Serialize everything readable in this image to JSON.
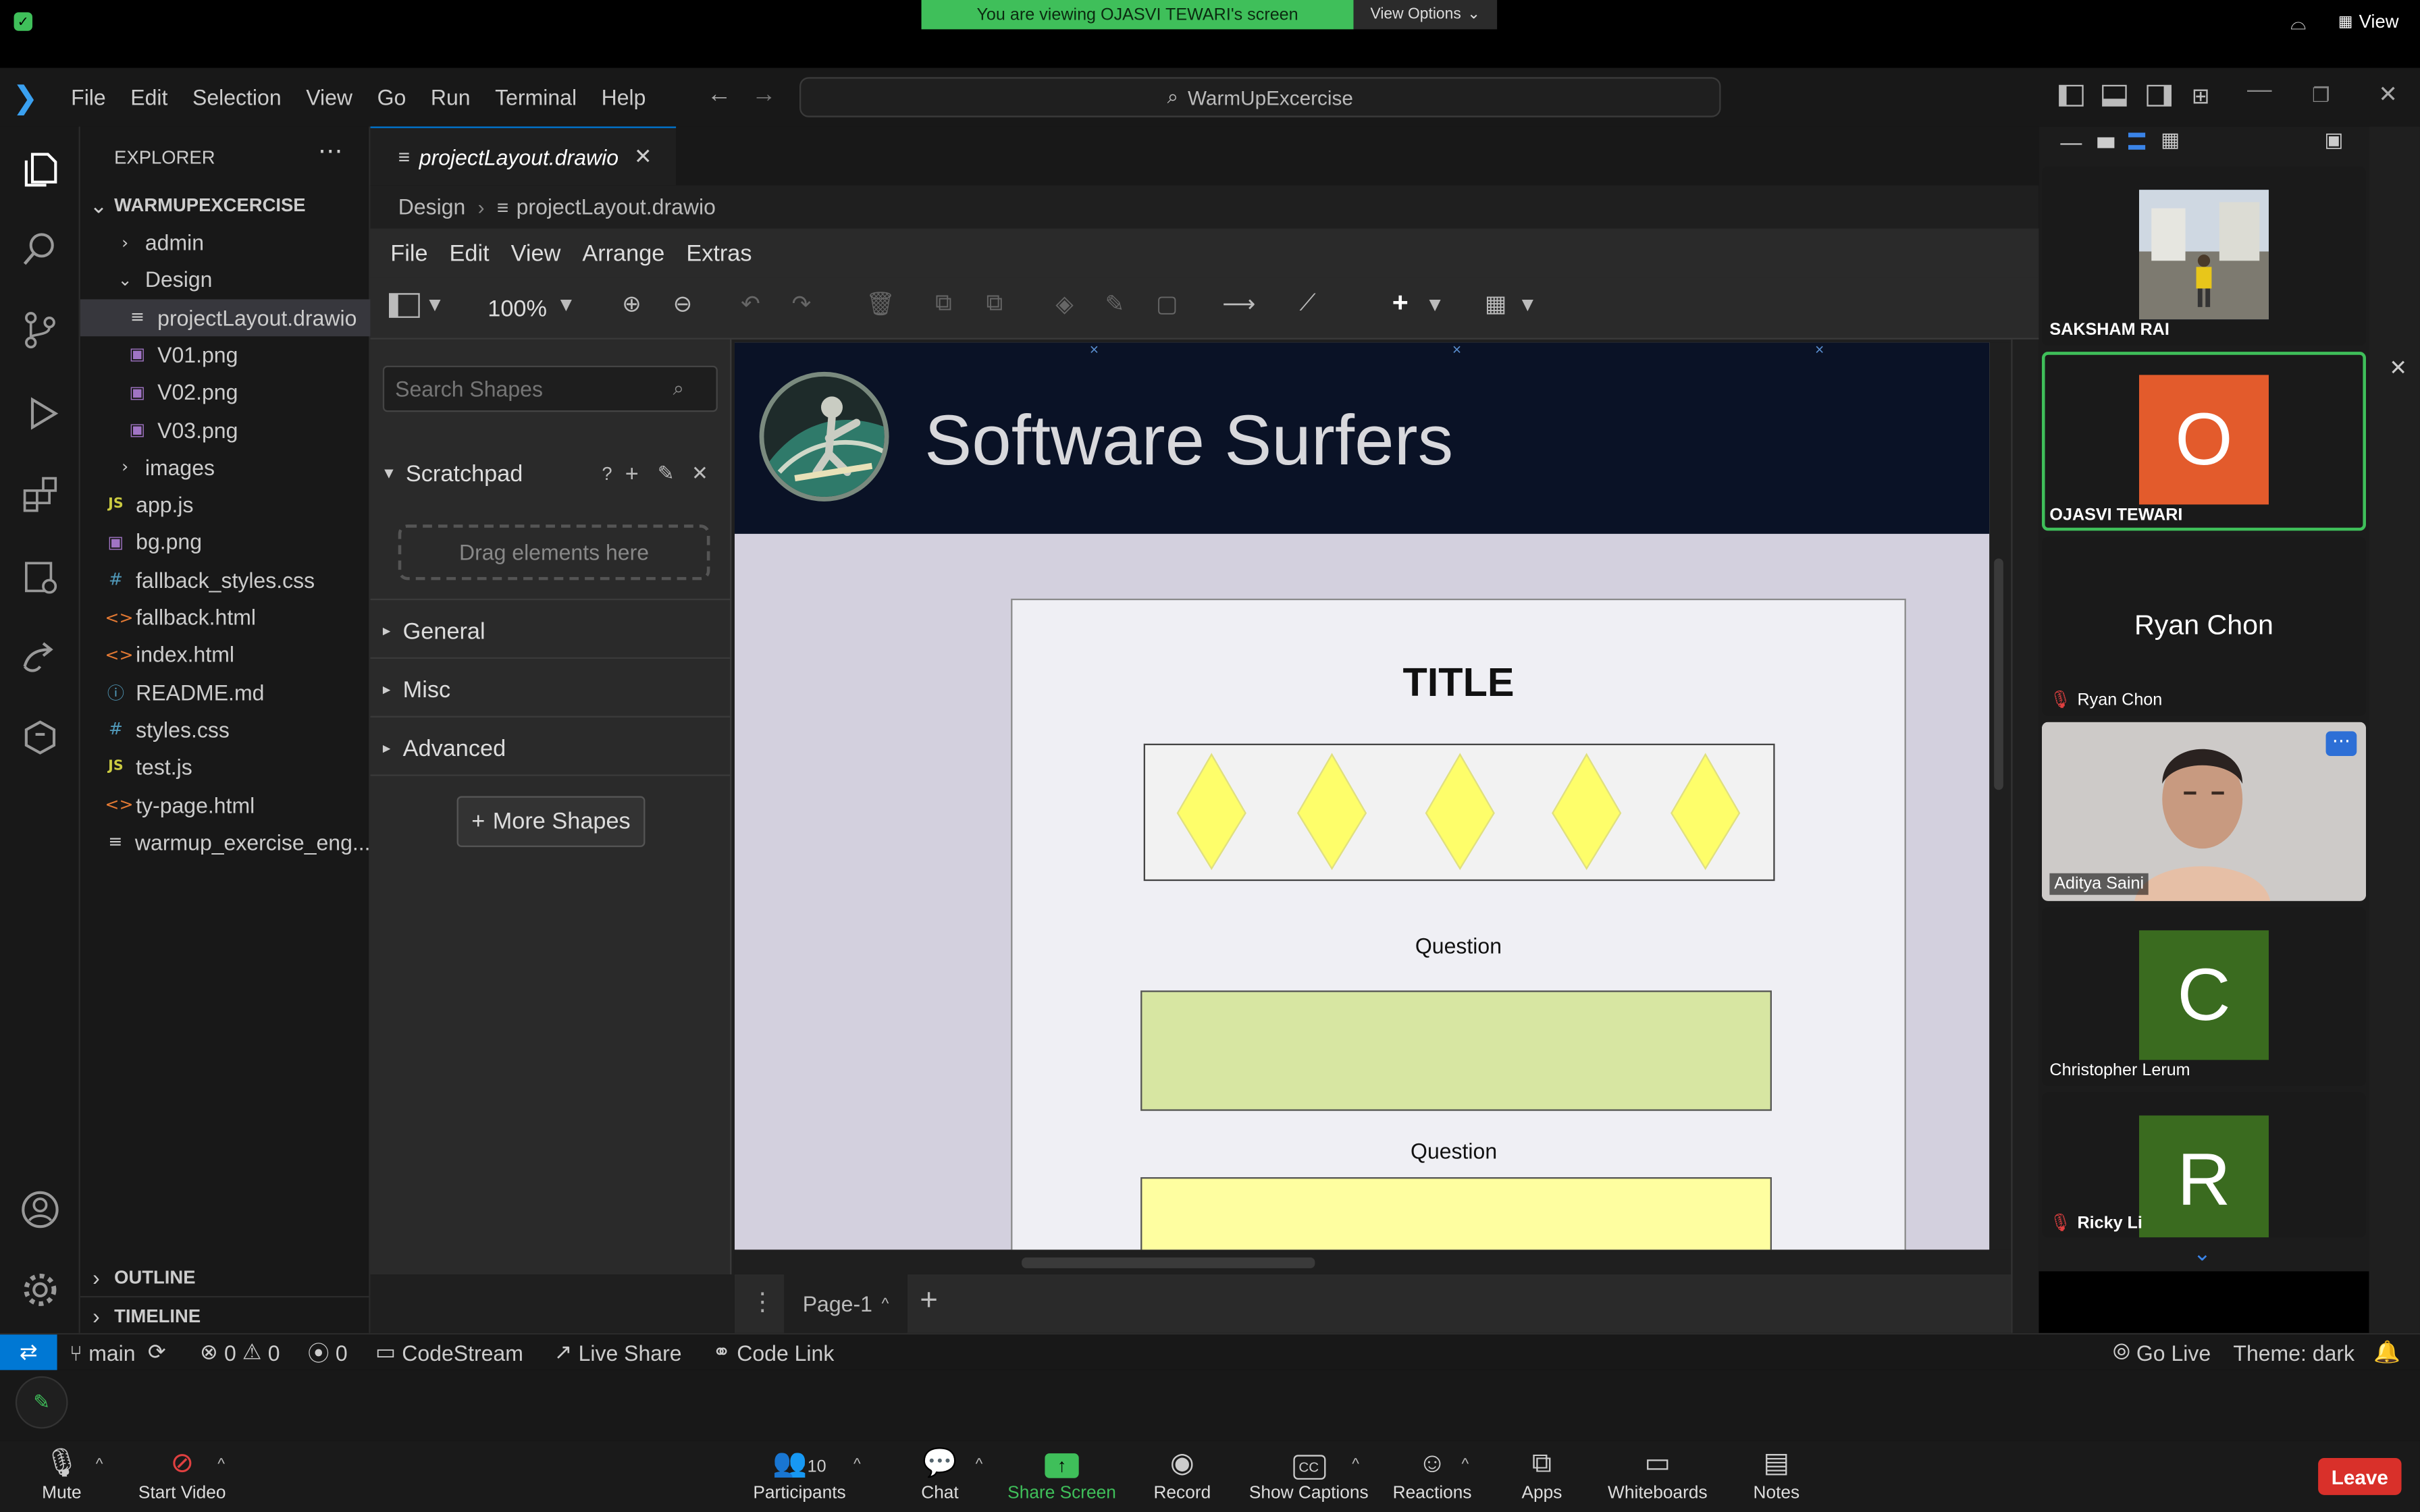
{
  "zoom": {
    "banner": "You are viewing OJASVI TEWARI's screen",
    "view_options": "View Options",
    "view_label": "View",
    "bottom_bar": {
      "mute": "Mute",
      "start_video": "Start Video",
      "participants": "Participants",
      "participant_count": "10",
      "chat": "Chat",
      "share_screen": "Share Screen",
      "record": "Record",
      "show_captions": "Show Captions",
      "reactions": "Reactions",
      "apps": "Apps",
      "whiteboards": "Whiteboards",
      "notes": "Notes",
      "leave": "Leave"
    },
    "participants": [
      {
        "name": "SAKSHAM RAI",
        "type": "video"
      },
      {
        "name": "OJASVI TEWARI",
        "initial": "O",
        "color": "#e35b2c",
        "active": true
      },
      {
        "name": "Ryan Chon",
        "display": "Ryan Chon",
        "muted": true
      },
      {
        "name": "Aditya Saini",
        "type": "video"
      },
      {
        "name": "Christopher Lerum",
        "initial": "C",
        "color": "#3a6b1f"
      },
      {
        "name": "Ricky Li",
        "initial": "R",
        "color": "#3a6b1f",
        "muted": true
      }
    ]
  },
  "vscode": {
    "menu": [
      "File",
      "Edit",
      "Selection",
      "View",
      "Go",
      "Run",
      "Terminal",
      "Help"
    ],
    "search": "WarmUpExcercise",
    "explorer_title": "EXPLORER",
    "workspace": "WARMUPEXCERCISE",
    "tree": [
      {
        "label": "admin",
        "kind": "folder",
        "indent": 1
      },
      {
        "label": "Design",
        "kind": "folder-open",
        "indent": 1
      },
      {
        "label": "projectLayout.drawio",
        "kind": "drawio",
        "indent": 2,
        "selected": true
      },
      {
        "label": "V01.png",
        "kind": "img",
        "indent": 2
      },
      {
        "label": "V02.png",
        "kind": "img",
        "indent": 2
      },
      {
        "label": "V03.png",
        "kind": "img",
        "indent": 2
      },
      {
        "label": "images",
        "kind": "folder",
        "indent": 1
      },
      {
        "label": "app.js",
        "kind": "js",
        "indent": 1
      },
      {
        "label": "bg.png",
        "kind": "img",
        "indent": 1
      },
      {
        "label": "fallback_styles.css",
        "kind": "css",
        "indent": 1
      },
      {
        "label": "fallback.html",
        "kind": "html",
        "indent": 1
      },
      {
        "label": "index.html",
        "kind": "html",
        "indent": 1
      },
      {
        "label": "README.md",
        "kind": "info",
        "indent": 1
      },
      {
        "label": "styles.css",
        "kind": "css",
        "indent": 1
      },
      {
        "label": "test.js",
        "kind": "js",
        "indent": 1
      },
      {
        "label": "ty-page.html",
        "kind": "html",
        "indent": 1
      },
      {
        "label": "warmup_exercise_eng...",
        "kind": "text",
        "indent": 1
      }
    ],
    "outline": "OUTLINE",
    "timeline": "TIMELINE",
    "tab": "projectLayout.drawio",
    "breadcrumb": [
      "Design",
      "projectLayout.drawio"
    ],
    "status": {
      "branch": "main",
      "errors": "0",
      "warnings": "0",
      "ports": "0",
      "codestream": "CodeStream",
      "liveshare": "Live Share",
      "codelink": "Code Link",
      "golive": "Go Live",
      "theme": "Theme: dark"
    }
  },
  "drawio": {
    "menu": [
      "File",
      "Edit",
      "View",
      "Arrange",
      "Extras"
    ],
    "zoom": "100%",
    "search_placeholder": "Search Shapes",
    "scratchpad": "Scratchpad",
    "drag_here": "Drag elements here",
    "sections": [
      "General",
      "Misc",
      "Advanced"
    ],
    "more_shapes": "More Shapes",
    "page_tab": "Page-1",
    "canvas": {
      "header_title": "Software Surfers",
      "page_title": "TITLE",
      "question1": "Question",
      "question2": "Question",
      "colors": {
        "diamond": "#fefe6a",
        "box1": "#d7e6a2",
        "box2": "#fefea0",
        "header": "#0a1226"
      }
    }
  }
}
